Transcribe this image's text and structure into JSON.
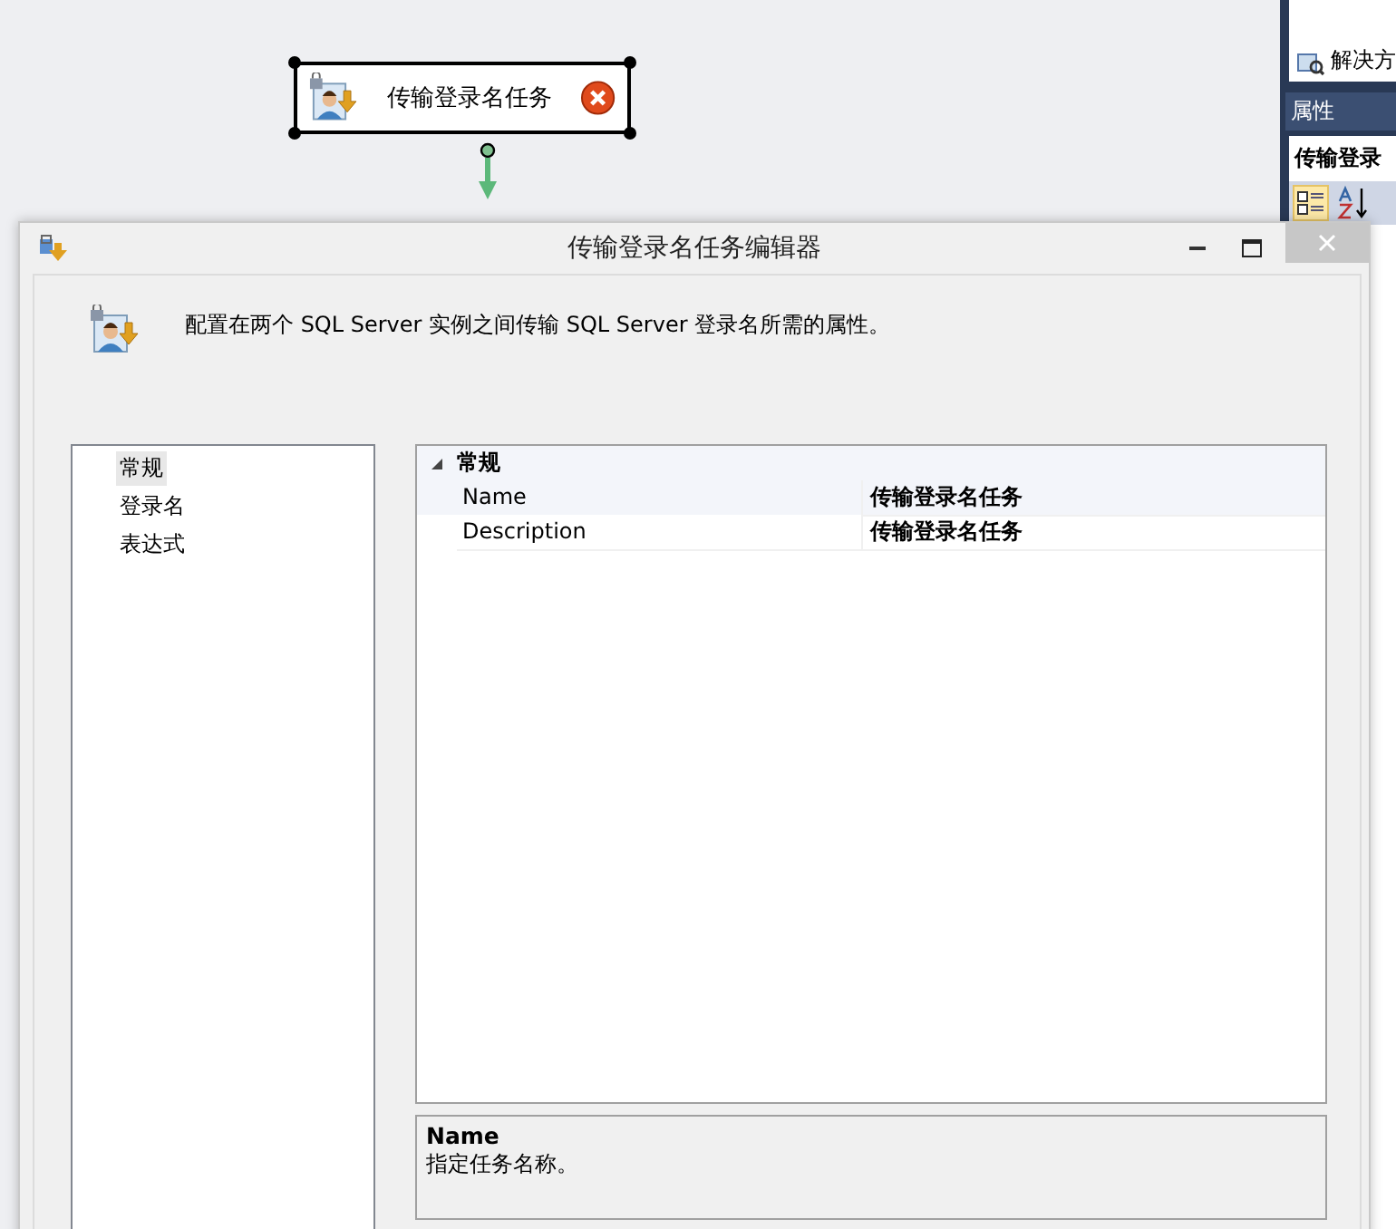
{
  "task_node": {
    "label": "传输登录名任务",
    "has_error": true
  },
  "side_panel": {
    "solution_tab": "解决方",
    "properties_title": "属性",
    "object_name": "传输登录"
  },
  "dialog": {
    "title": "传输登录名任务编辑器",
    "description": "配置在两个 SQL Server 实例之间传输 SQL Server 登录名所需的属性。",
    "pages": [
      {
        "label": "常规",
        "selected": true
      },
      {
        "label": "登录名",
        "selected": false
      },
      {
        "label": "表达式",
        "selected": false
      }
    ],
    "property_grid": {
      "category": {
        "label": "常规",
        "expanded": true
      },
      "rows": [
        {
          "name": "Name",
          "value": "传输登录名任务"
        },
        {
          "name": "Description",
          "value": "传输登录名任务"
        }
      ]
    },
    "help": {
      "title": "Name",
      "text": "指定任务名称。"
    }
  }
}
